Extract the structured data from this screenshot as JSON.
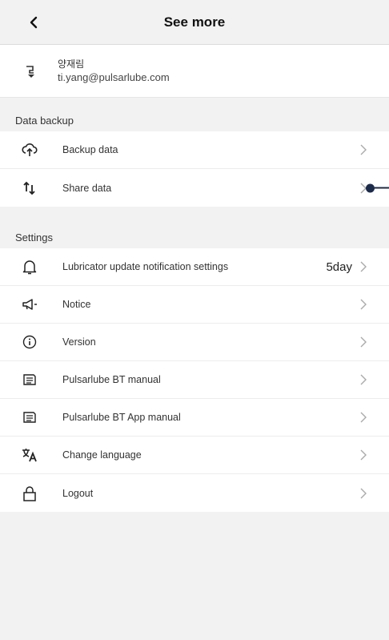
{
  "header": {
    "title": "See more"
  },
  "profile": {
    "name": "양재림",
    "email": "ti.yang@pulsarlube.com"
  },
  "sections": {
    "backup": {
      "title": "Data backup",
      "items": [
        {
          "label": "Backup data",
          "icon": "cloud-upload-icon"
        },
        {
          "label": "Share data",
          "icon": "transfer-arrows-icon"
        }
      ]
    },
    "settings": {
      "title": "Settings",
      "items": [
        {
          "label": "Lubricator update notification settings",
          "icon": "bell-icon",
          "value": "5day"
        },
        {
          "label": "Notice",
          "icon": "megaphone-icon"
        },
        {
          "label": "Version",
          "icon": "info-icon"
        },
        {
          "label": "Pulsarlube BT manual",
          "icon": "manual-icon"
        },
        {
          "label": "Pulsarlube BT App manual",
          "icon": "manual-icon"
        },
        {
          "label": "Change language",
          "icon": "translate-icon"
        },
        {
          "label": "Logout",
          "icon": "lock-icon"
        }
      ]
    }
  },
  "colors": {
    "background": "#f2f2f2",
    "indicator": "#1c2a4a"
  }
}
